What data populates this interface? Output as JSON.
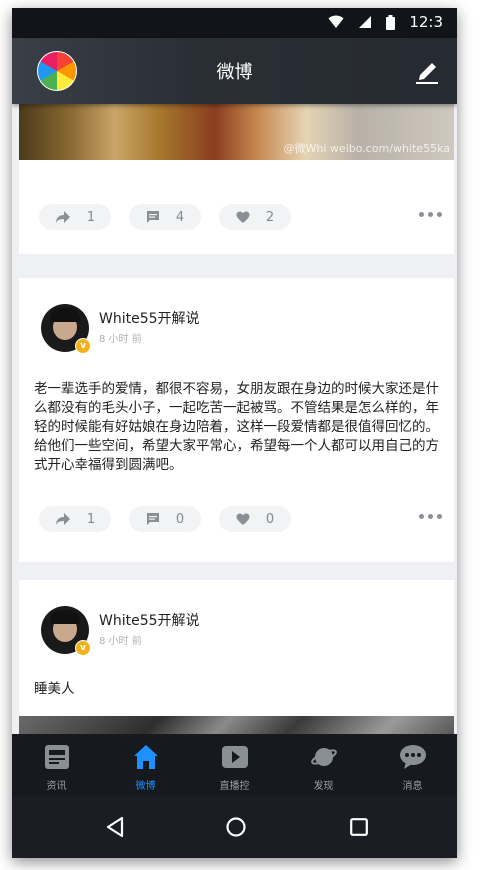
{
  "status_bar": {
    "time": "12:3"
  },
  "app_bar": {
    "title": "微博"
  },
  "posts": [
    {
      "image_watermark": "@微Whi weibo.com/white55ka",
      "actions": {
        "shares": "1",
        "comments": "4",
        "likes": "2"
      }
    },
    {
      "username": "White55开解说",
      "time": "8 小时 前",
      "text": "老一辈选手的爱情，都很不容易，女朋友跟在身边的时候大家还是什么都没有的毛头小子，一起吃苦一起被骂。不管结果是怎么样的，年轻的时候能有好姑娘在身边陪着，这样一段爱情都是很值得回忆的。给他们一些空间，希望大家平常心，希望每一个人都可以用自己的方式开心幸福得到圆满吧。",
      "actions": {
        "shares": "1",
        "comments": "0",
        "likes": "0"
      }
    },
    {
      "username": "White55开解说",
      "time": "8 小时 前",
      "text": "睡美人"
    }
  ],
  "verified_badge": "v",
  "tabs": [
    {
      "label": "资讯",
      "icon": "news-icon"
    },
    {
      "label": "微博",
      "icon": "home-icon"
    },
    {
      "label": "直播控",
      "icon": "play-icon"
    },
    {
      "label": "发现",
      "icon": "planet-icon"
    },
    {
      "label": "消息",
      "icon": "message-icon"
    }
  ],
  "colors": {
    "accent": "#1e90ff",
    "badge": "#f3b21b",
    "appbar": "#2a2e35"
  }
}
